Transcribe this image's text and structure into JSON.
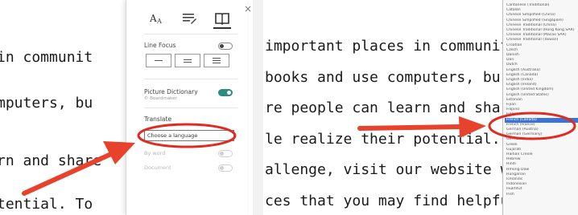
{
  "left_panel": {
    "reader_lines": [
      "in communit",
      "mputers, bu",
      "rn and share",
      "tential. To"
    ],
    "settings_panel": {
      "tabs": [
        {
          "icon": "text-size-icon"
        },
        {
          "icon": "grammar-options-icon"
        },
        {
          "icon": "reading-preferences-book-icon",
          "active": true
        }
      ],
      "close_icon": "×",
      "line_focus": {
        "label": "Line Focus",
        "on": false
      },
      "line_options": [
        "one-line",
        "three-lines",
        "five-lines"
      ],
      "picture_dictionary": {
        "label": "Picture Dictionary",
        "sublabel": "© Boardmaker",
        "on": true
      },
      "translate": {
        "label": "Translate",
        "select_placeholder": "Choose a language",
        "by_word_label": "By word",
        "document_label": "Document"
      }
    }
  },
  "right_panel": {
    "reader_lines": [
      "important places in communit",
      "books and use computers, bu",
      "re people can learn and share",
      "le realize their potential. To",
      "allenge, visit our website whe",
      "ces that you may find helpful."
    ],
    "language_list": [
      "Cantonese (Traditional)",
      "Catalan",
      "Chinese Simplified (China)",
      "Chinese Simplified (Singapore)",
      "Chinese Traditional (China)",
      "Chinese Traditional (Hong Kong SAR)",
      "Chinese Traditional (Macao SAR)",
      "Chinese Traditional (Taiwan)",
      "Croatian",
      "Czech",
      "Danish",
      "Dari",
      "Dutch",
      "English (Australia)",
      "English (Canada)",
      "English (India)",
      "English (Ireland)",
      "English (United Kingdom)",
      "English (United States)",
      "Estonian",
      "Fijian",
      "Filipino",
      "Finnish",
      "French (Canada)",
      "French (France)",
      "German (Austria)",
      "German (Germany)",
      "German (Switzerland)",
      "Greek",
      "Gujarati",
      "Haitian Creole",
      "Hebrew",
      "Hindi",
      "Hmong Daw",
      "Hungarian",
      "Icelandic",
      "Indonesian",
      "Inuktitut",
      "Irish"
    ],
    "selected_language": "French (Canada)"
  },
  "annotations": {
    "arrow_color": "#e8412c",
    "highlight_color": "#e02b20"
  }
}
